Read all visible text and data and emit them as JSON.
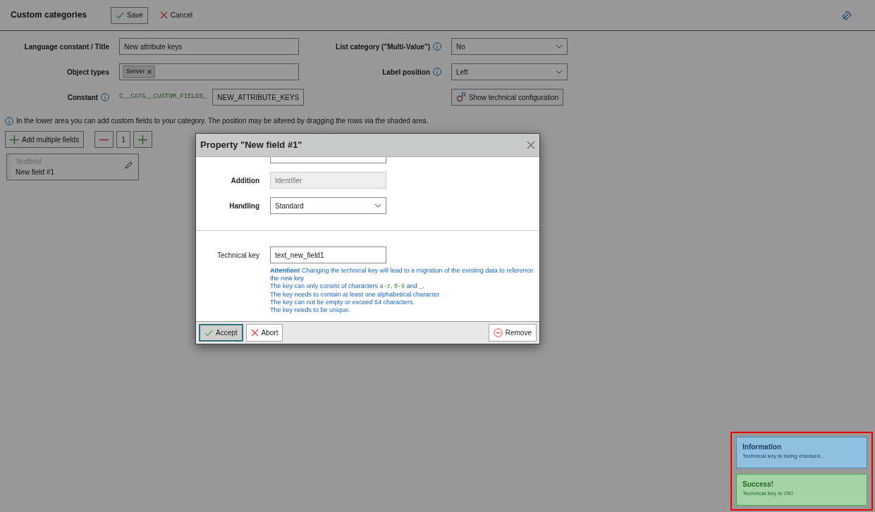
{
  "header": {
    "title": "Custom categories",
    "buttons": [
      {
        "kind": "save",
        "label": "Save"
      },
      {
        "kind": "cancel",
        "label": "Cancel"
      }
    ]
  },
  "form": {
    "left": [
      {
        "label": "Language constant / Title",
        "kind": "text",
        "value": "New attribute keys"
      },
      {
        "label": "Object types",
        "kind": "tags",
        "tags": [
          "Server"
        ]
      },
      {
        "label": "Constant",
        "kind": "constant",
        "info": true,
        "prefix": "C__CATG__CUSTOM_FIELDS_",
        "value": "NEW_ATTRIBUTE_KEYS"
      }
    ],
    "right": [
      {
        "label": "List category (\"Multi-Value\")",
        "kind": "select",
        "info": true,
        "value": "No"
      },
      {
        "label": "Label position",
        "kind": "select",
        "info": true,
        "value": "Left"
      },
      {
        "kind": "button",
        "value": "Show technical configuration"
      }
    ]
  },
  "hint": "In the lower area you can add custom fields to your category. The position may be altered by dragging the rows via the shaded area.",
  "toolbar": {
    "add_label": "Add multiple fields",
    "count": "1"
  },
  "fields": [
    {
      "type": "Textfield",
      "name": "New field #1"
    }
  ],
  "dialog": {
    "title": "Property \"New field #1\"",
    "rows": [
      {
        "label": "Addition",
        "kind": "readonly",
        "placeholder": "Identifier"
      },
      {
        "label": "Handling",
        "kind": "select",
        "value": "Standard"
      }
    ],
    "key_label": "Technical key",
    "key_value": "text_new_field1",
    "help": [
      [
        {
          "kind": "text",
          "text": "**Attention!** Changing the technical key will lead to a migration of the existing data to reference the new key"
        }
      ],
      [
        {
          "kind": "text",
          "text": "The key can only consist of characters "
        },
        {
          "kind": "code",
          "text": "a-z"
        },
        {
          "kind": "text",
          "text": ", "
        },
        {
          "kind": "code",
          "text": "0-9"
        },
        {
          "kind": "text",
          "text": " and "
        },
        {
          "kind": "code",
          "text": "_"
        },
        {
          "kind": "text",
          "text": "."
        }
      ],
      [
        {
          "kind": "text",
          "text": "The key needs to contain at least one alphabetical character."
        }
      ],
      [
        {
          "kind": "text",
          "text": "The key can not be empty or exceed 64 characters."
        }
      ],
      [
        {
          "kind": "text",
          "text": "The key needs to be unique."
        }
      ]
    ],
    "buttons": [
      {
        "kind": "accept",
        "label": "Accept",
        "selected": true
      },
      {
        "kind": "abort",
        "label": "Abort",
        "selected": false
      },
      {
        "kind": "remove",
        "label": "Remove",
        "selected": false
      }
    ]
  },
  "toasts": [
    {
      "kind": "info",
      "title": "Information",
      "text": "Technical key is being checked..."
    },
    {
      "kind": "success",
      "title": "Success!",
      "text": "Technical key is OK!"
    }
  ]
}
